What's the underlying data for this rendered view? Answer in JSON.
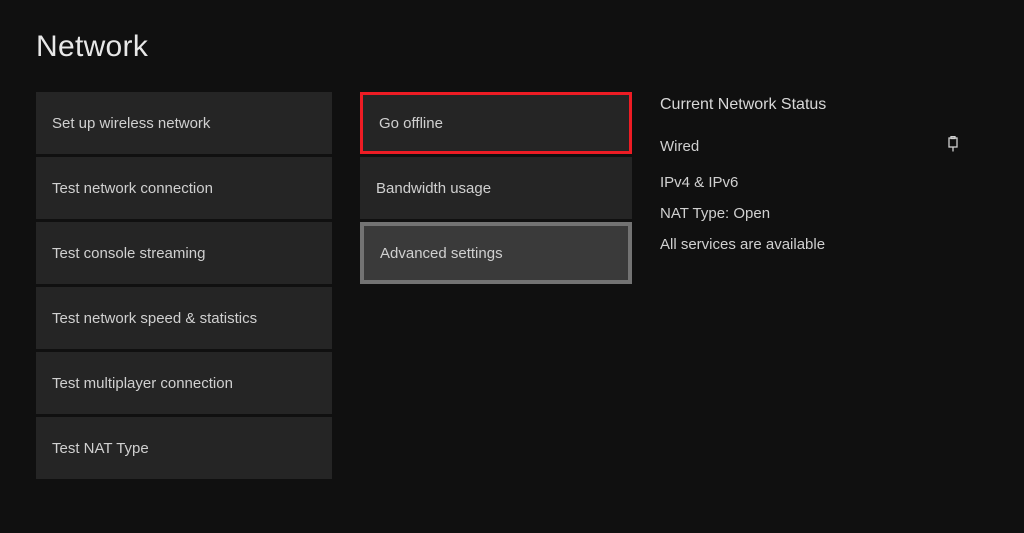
{
  "title": "Network",
  "left_column": [
    {
      "label": "Set up wireless network"
    },
    {
      "label": "Test network connection"
    },
    {
      "label": "Test console streaming"
    },
    {
      "label": "Test network speed & statistics"
    },
    {
      "label": "Test multiplayer connection"
    },
    {
      "label": "Test NAT Type"
    }
  ],
  "mid_column": [
    {
      "label": "Go offline",
      "highlight": "red"
    },
    {
      "label": "Bandwidth usage",
      "highlight": ""
    },
    {
      "label": "Advanced settings",
      "highlight": "grey"
    }
  ],
  "status": {
    "heading": "Current Network Status",
    "connection": "Wired",
    "ip": "IPv4 & IPv6",
    "nat": "NAT Type: Open",
    "services": "All services are available"
  }
}
